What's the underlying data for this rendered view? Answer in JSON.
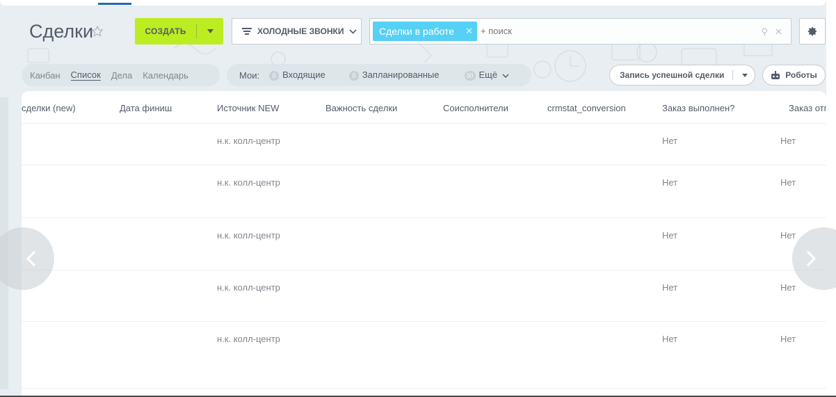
{
  "header": {
    "title": "Сделки",
    "create_label": "СОЗДАТЬ",
    "filter_preset_label": "ХОЛОДНЫЕ ЗВОНКИ",
    "search_tag": "Сделки в работе",
    "search_placeholder": "+ поиск"
  },
  "toolbar": {
    "views": [
      "Канбан",
      "Список",
      "Дела",
      "Календарь"
    ],
    "active_view": "Список",
    "my_label": "Мои:",
    "counters": [
      {
        "count": "0",
        "label": "Входящие"
      },
      {
        "count": "0",
        "label": "Запланированные"
      },
      {
        "count": "30",
        "label": "Ещё"
      }
    ],
    "success_button": "Запись успешной сделки",
    "robots_button": "Роботы"
  },
  "grid": {
    "columns": [
      "сделки (new)",
      "Дата финиш",
      "Источник NEW",
      "Важность сделки",
      "Соисполнители",
      "crmstat_conversion",
      "Заказ выполнен?",
      "Заказ отг"
    ],
    "rows": [
      {
        "source": "н.к. колл-центр",
        "done": "Нет",
        "shipped": "Нет"
      },
      {
        "source": "н.к. колл-центр",
        "done": "Нет",
        "shipped": "Нет"
      },
      {
        "source": "н.к. колл-центр",
        "done": "Нет",
        "shipped": "Нет"
      },
      {
        "source": "н.к. колл-центр",
        "done": "Нет",
        "shipped": "Нет"
      },
      {
        "source": "н.к. колл-центр",
        "done": "Нет",
        "shipped": "Нет"
      }
    ]
  },
  "colors": {
    "accent_green": "#bbed21",
    "tag_blue": "#56d0f5",
    "text_dark": "#535c69",
    "text_muted": "#80868e"
  },
  "icons": [
    "star-icon",
    "chevron-down-icon",
    "filter-icon",
    "close-icon",
    "search-icon",
    "gear-icon",
    "robot-icon",
    "arrow-left-icon",
    "arrow-right-icon"
  ]
}
